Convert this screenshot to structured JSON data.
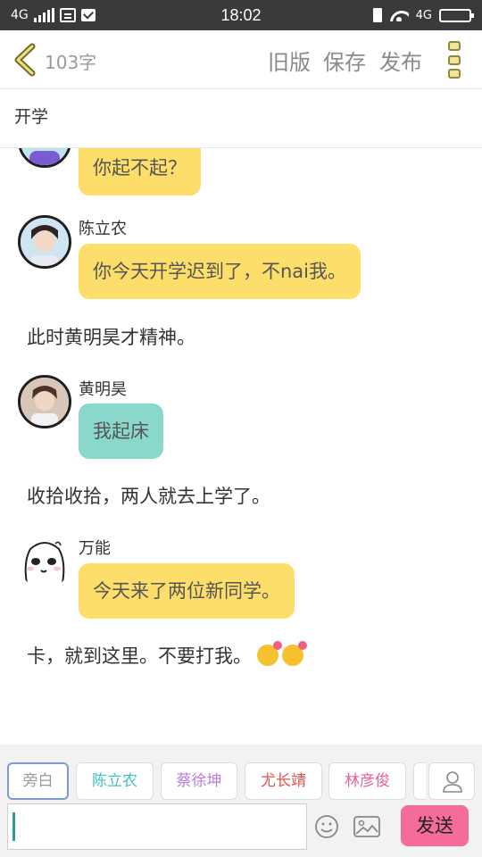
{
  "status_bar": {
    "network": "4G",
    "time": "18:02",
    "network_right": "4G"
  },
  "header": {
    "word_count": "103字",
    "actions": [
      "旧版",
      "保存",
      "发布"
    ]
  },
  "story_title": "开学",
  "messages": [
    {
      "type": "bubble",
      "speaker": "",
      "text": "你起不起？",
      "color": "#fede6a",
      "avatar": "boy-avatar-icon"
    },
    {
      "type": "bubble",
      "speaker": "陈立农",
      "text": "你今天开学迟到了，不nai我。",
      "color": "#fede6a",
      "avatar": "boy-avatar-icon"
    },
    {
      "type": "narration",
      "text": "此时黄明昊才精神。"
    },
    {
      "type": "bubble",
      "speaker": "黄明昊",
      "text": "我起床",
      "color": "#8ad8cc",
      "avatar": "boy-avatar-icon"
    },
    {
      "type": "narration",
      "text": "收拾收拾，两人就去上学了。"
    },
    {
      "type": "bubble",
      "speaker": "万能",
      "text": "今天来了两位新同学。",
      "color": "#fede6a",
      "avatar": "cartoon-face-icon"
    },
    {
      "type": "narration",
      "text": "卡，就到这里。不要打我。"
    }
  ],
  "characters": [
    {
      "label": "旁白",
      "color": "#999999",
      "selected": true
    },
    {
      "label": "陈立农",
      "color": "#3fc0c0",
      "selected": false
    },
    {
      "label": "蔡徐坤",
      "color": "#b77fd9",
      "selected": false
    },
    {
      "label": "尤长靖",
      "color": "#e8524a",
      "selected": false
    },
    {
      "label": "林彦俊",
      "color": "#e8609a",
      "selected": false
    }
  ],
  "composer": {
    "input_value": "",
    "send_label": "发送"
  },
  "colors": {
    "bubble_yellow": "#fede6a",
    "bubble_teal": "#8ad8cc",
    "send_pink": "#f56c9a",
    "status_bar": "#3a3a3a"
  }
}
